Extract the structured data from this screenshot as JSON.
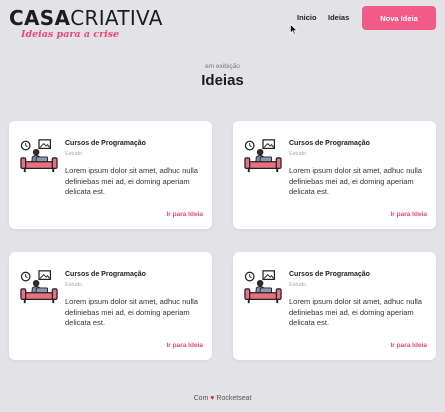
{
  "header": {
    "logo_bold": "CASA",
    "logo_light": "CRIATIVA",
    "tagline": "Ideias para a crise",
    "nav": {
      "home": "Inicio",
      "ideas": "Ideias"
    },
    "new_button": "Nova Ideia"
  },
  "main": {
    "label": "em exibição",
    "title": "Ideias",
    "cards": [
      {
        "title": "Cursos de Programação",
        "category": "Estudo",
        "description": "Lorem ipsum dolor sit amet, adhuc nulla definiebas mei ad, ei doming aperiam delicata est.",
        "link": "Ir para Ideia"
      },
      {
        "title": "Cursos de Programação",
        "category": "Estudo",
        "description": "Lorem ipsum dolor sit amet, adhuc nulla definiebas mei ad, ei doming aperiam delicata est.",
        "link": "Ir para Ideia"
      },
      {
        "title": "Cursos de Programação",
        "category": "Estudo",
        "description": "Lorem ipsum dolor sit amet, adhuc nulla definiebas mei ad, ei doming aperiam delicata est.",
        "link": "Ir para Ideia"
      },
      {
        "title": "Cursos de Programação",
        "category": "Estudo",
        "description": "Lorem ipsum dolor sit amet, adhuc nulla definiebas mei ad, ei doming aperiam delicata est.",
        "link": "Ir para Ideia"
      }
    ]
  },
  "footer": {
    "prefix": "Com",
    "heart": "♥",
    "suffix": "Rocketseat"
  },
  "colors": {
    "background": "#e3e2e6",
    "accent": "#f25b85",
    "link": "#e54a75",
    "card": "#ffffff"
  },
  "icons": {
    "card_illustration": "person-studying-laptop-icon",
    "cursor": "mouse-pointer-icon",
    "heart": "heart-icon"
  }
}
